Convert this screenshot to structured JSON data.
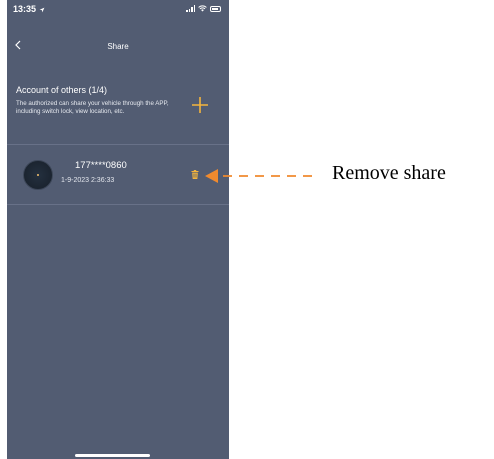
{
  "status_bar": {
    "time": "13:35",
    "icons": [
      "location-arrow-icon",
      "signal-icon",
      "wifi-icon",
      "battery-icon"
    ]
  },
  "nav": {
    "title": "Share",
    "back_icon": "chevron-left-icon"
  },
  "account_section": {
    "title": "Account of others (1/4)",
    "description": "The authorized  can share your vehicle through the APP, including switch lock, view location, etc.",
    "add_icon": "plus-icon"
  },
  "shares": [
    {
      "phone": "177****0860",
      "datetime": "1-9-2023 2:36:33",
      "delete_icon": "trash-icon"
    }
  ],
  "annotation": {
    "label": "Remove share"
  },
  "colors": {
    "background": "#525c72",
    "accent": "#f5b53d",
    "annotation_arrow": "#f08a2e"
  }
}
